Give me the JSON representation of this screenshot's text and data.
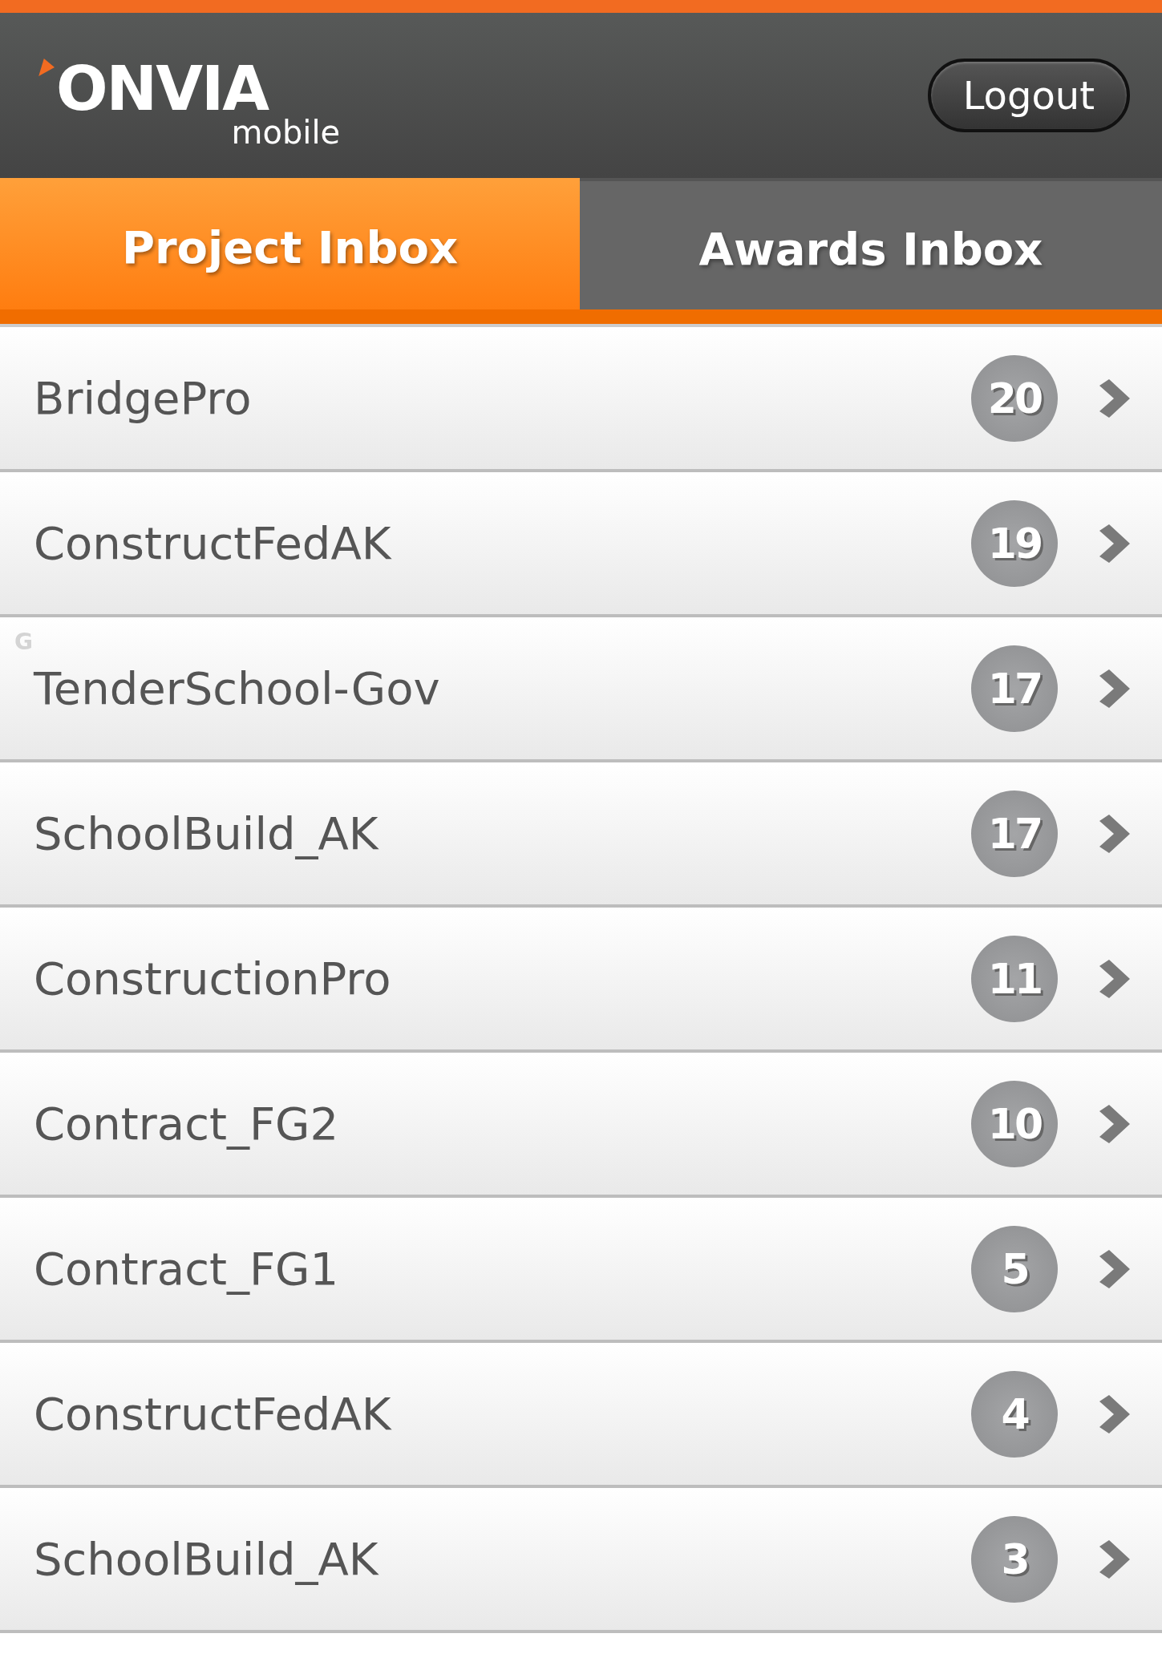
{
  "header": {
    "logo": "ONVIA",
    "logo_sub": "mobile",
    "logout": "Logout"
  },
  "tabs": [
    {
      "label": "Project Inbox",
      "selected": true
    },
    {
      "label": "Awards Inbox",
      "selected": false
    }
  ],
  "rows": [
    {
      "name": "BridgePro",
      "count": "20"
    },
    {
      "name": "ConstructFedAK",
      "count": "19"
    },
    {
      "name": "TenderSchool-Gov",
      "count": "17",
      "faint_mark": "G"
    },
    {
      "name": "SchoolBuild_AK",
      "count": "17"
    },
    {
      "name": "ConstructionPro",
      "count": "11"
    },
    {
      "name": "Contract_FG2",
      "count": "10"
    },
    {
      "name": "Contract_FG1",
      "count": "5"
    },
    {
      "name": "ConstructFedAK",
      "count": "4"
    },
    {
      "name": "SchoolBuild_AK",
      "count": "3"
    }
  ]
}
